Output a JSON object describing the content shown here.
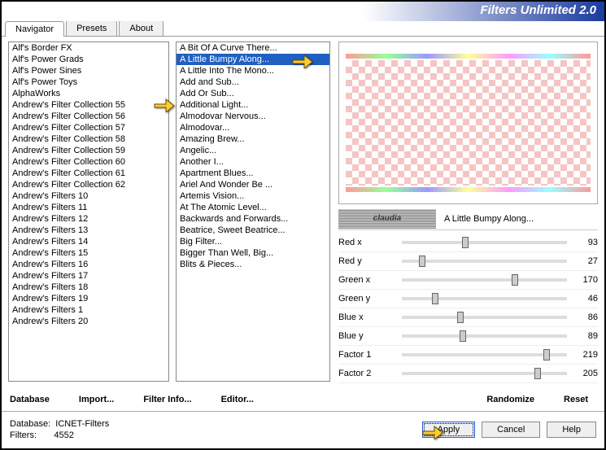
{
  "title": "Filters Unlimited 2.0",
  "tabs": [
    "Navigator",
    "Presets",
    "About"
  ],
  "activeTab": 0,
  "categories": [
    "Alf's Border FX",
    "Alf's Power Grads",
    "Alf's Power Sines",
    "Alf's Power Toys",
    "AlphaWorks",
    "Andrew's Filter Collection 55",
    "Andrew's Filter Collection 56",
    "Andrew's Filter Collection 57",
    "Andrew's Filter Collection 58",
    "Andrew's Filter Collection 59",
    "Andrew's Filter Collection 60",
    "Andrew's Filter Collection 61",
    "Andrew's Filter Collection 62",
    "Andrew's Filters 10",
    "Andrew's Filters 11",
    "Andrew's Filters 12",
    "Andrew's Filters 13",
    "Andrew's Filters 14",
    "Andrew's Filters 15",
    "Andrew's Filters 16",
    "Andrew's Filters 17",
    "Andrew's Filters 18",
    "Andrew's Filters 19",
    "Andrew's Filters 1",
    "Andrew's Filters 20"
  ],
  "filters": [
    "A Bit Of A Curve There...",
    "A Little Bumpy Along...",
    "A Little Into The Mono...",
    "Add and Sub...",
    "Add Or Sub...",
    "Additional Light...",
    "Almodovar Nervous...",
    "Almodovar...",
    "Amazing Brew...",
    "Angelic...",
    "Another I...",
    "Apartment Blues...",
    "Ariel And Wonder Be ...",
    "Artemis Vision...",
    "At The Atomic Level...",
    "Backwards and Forwards...",
    "Beatrice, Sweet Beatrice...",
    "Big Filter...",
    "Bigger Than Well, Big...",
    "Blits & Pieces..."
  ],
  "selectedFilter": 1,
  "currentFilterName": "A Little Bumpy Along...",
  "watermark": "claudia",
  "params": [
    {
      "label": "Red x",
      "value": 93
    },
    {
      "label": "Red y",
      "value": 27
    },
    {
      "label": "Green x",
      "value": 170
    },
    {
      "label": "Green y",
      "value": 46
    },
    {
      "label": "Blue x",
      "value": 86
    },
    {
      "label": "Blue y",
      "value": 89
    },
    {
      "label": "Factor 1",
      "value": 219
    },
    {
      "label": "Factor 2",
      "value": 205
    }
  ],
  "buttons": {
    "database": "Database",
    "import": "Import...",
    "filterinfo": "Filter Info...",
    "editor": "Editor...",
    "randomize": "Randomize",
    "reset": "Reset",
    "apply": "Apply",
    "cancel": "Cancel",
    "help": "Help"
  },
  "status": {
    "dbLabel": "Database:",
    "dbValue": "ICNET-Filters",
    "filtersLabel": "Filters:",
    "filtersValue": "4552"
  }
}
